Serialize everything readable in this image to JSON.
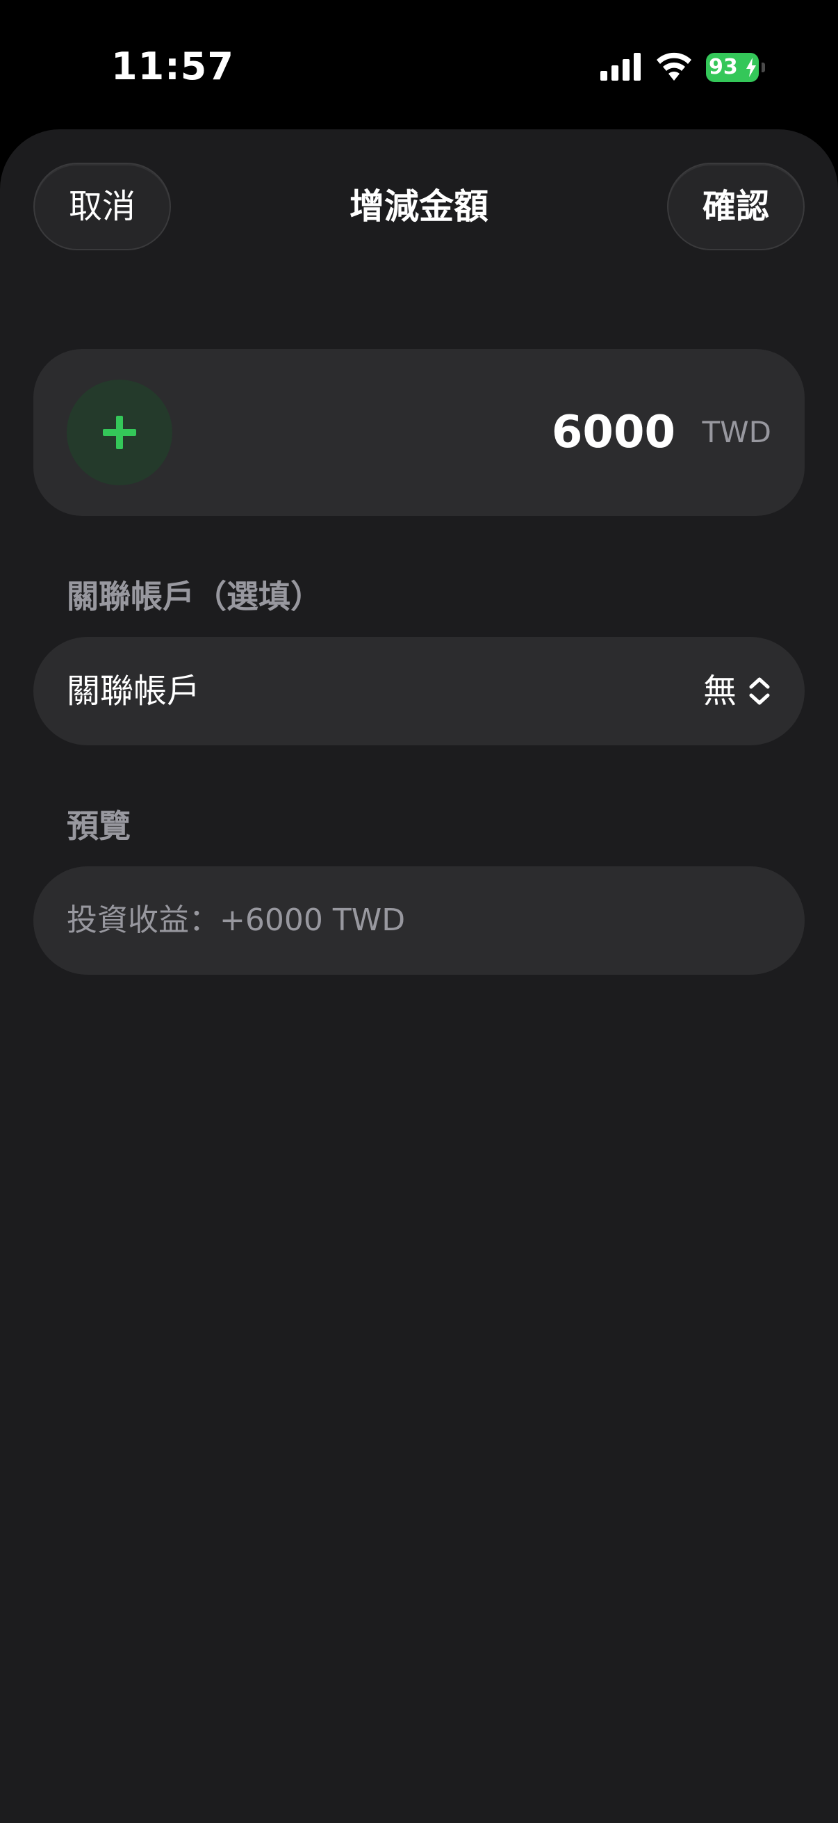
{
  "status_bar": {
    "time": "11:57",
    "battery_percent": "93",
    "battery_color": "#34c759",
    "icons": [
      "signal-icon",
      "wifi-icon",
      "battery-icon",
      "bolt-icon"
    ]
  },
  "header": {
    "title": "增減金額",
    "cancel_label": "取消",
    "confirm_label": "確認"
  },
  "amount": {
    "sign": "+",
    "value": "6000",
    "currency": "TWD",
    "accent_color": "#34c759"
  },
  "linked_account": {
    "section_label": "關聯帳戶（選填）",
    "row_label": "關聯帳戶",
    "selected_value": "無"
  },
  "preview": {
    "section_label": "預覽",
    "text": "投資收益：+6000 TWD"
  }
}
